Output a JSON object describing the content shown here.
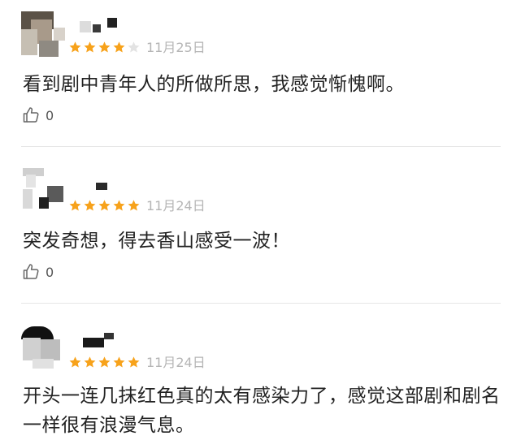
{
  "reviews": [
    {
      "rating": 4,
      "max_rating": 5,
      "date": "11月25日",
      "content": "看到剧中青年人的所做所思，我感觉惭愧啊。",
      "likes": "0"
    },
    {
      "rating": 5,
      "max_rating": 5,
      "date": "11月24日",
      "content": "突发奇想，得去香山感受一波！",
      "likes": "0"
    },
    {
      "rating": 5,
      "max_rating": 5,
      "date": "11月24日",
      "content": "开头一连几抹红色真的太有感染力了，感觉这部剧和剧名一样很有浪漫气息。"
    }
  ],
  "colors": {
    "star_filled": "#f7a21b",
    "star_empty": "#e3e3e3",
    "date": "#b5b5b5"
  },
  "icons": {
    "like": "thumbs-up-icon",
    "star": "star-icon"
  }
}
